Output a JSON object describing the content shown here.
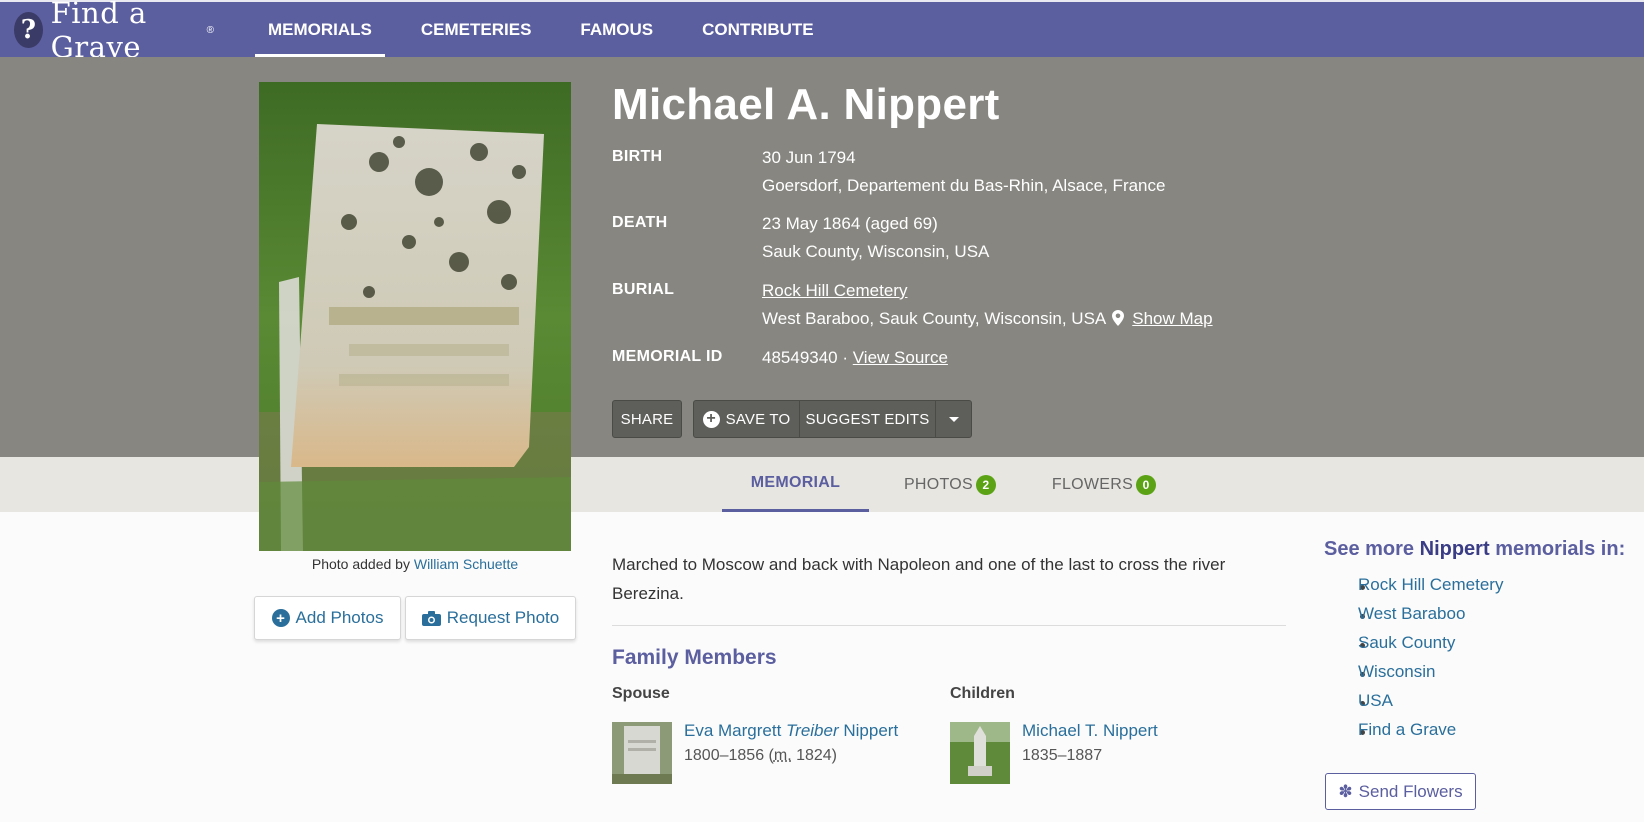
{
  "nav": {
    "logo_text": "Find a Grave",
    "items": [
      {
        "label": "MEMORIALS",
        "active": true
      },
      {
        "label": "CEMETERIES",
        "active": false
      },
      {
        "label": "FAMOUS",
        "active": false
      },
      {
        "label": "CONTRIBUTE",
        "active": false
      }
    ]
  },
  "photo": {
    "caption_prefix": "Photo added by",
    "caption_author": "William Schuette",
    "add_photos": "Add Photos",
    "request_photo": "Request Photo"
  },
  "memorial": {
    "name": "Michael A. Nippert",
    "birth_label": "BIRTH",
    "birth_date": "30 Jun 1794",
    "birth_place": "Goersdorf, Departement du Bas-Rhin, Alsace, France",
    "death_label": "DEATH",
    "death_date": "23 May 1864 (aged 69)",
    "death_place": "Sauk County, Wisconsin, USA",
    "burial_label": "BURIAL",
    "burial_cemetery": "Rock Hill Cemetery",
    "burial_place": "West Baraboo, Sauk County, Wisconsin, USA",
    "show_map": "Show Map",
    "id_label": "MEMORIAL ID",
    "id_value": "48549340 ·",
    "view_source": "View Source"
  },
  "actions": {
    "share": "SHARE",
    "save_to": "SAVE TO",
    "suggest_edits": "SUGGEST EDITS"
  },
  "tabs": [
    {
      "label": "MEMORIAL",
      "active": true
    },
    {
      "label": "PHOTOS",
      "count": "2"
    },
    {
      "label": "FLOWERS",
      "count": "0"
    }
  ],
  "bio": "Marched to Moscow and back with Napoleon and one of the last to cross the river Berezina.",
  "family": {
    "title": "Family Members",
    "spouse_heading": "Spouse",
    "spouse": {
      "first": "Eva Margrett",
      "maiden": "Treiber",
      "last": "Nippert",
      "dates": "1800–1856 (",
      "married_abbr": "m.",
      "married_year": " 1824)"
    },
    "children_heading": "Children",
    "child": {
      "name": "Michael T. Nippert",
      "dates": "1835–1887"
    }
  },
  "sidebar": {
    "see_more_prefix": "See more",
    "see_more_name": "Nippert",
    "see_more_suffix": "memorials in:",
    "links": [
      "Rock Hill Cemetery",
      "West Baraboo",
      "Sauk County",
      "Wisconsin",
      "USA",
      "Find a Grave"
    ],
    "send_flowers": "Send Flowers"
  },
  "colors": {
    "brand_purple": "#5b5e9f",
    "hero_gray": "#878680",
    "link_blue": "#2a6f9b",
    "badge_green": "#5ba315"
  }
}
